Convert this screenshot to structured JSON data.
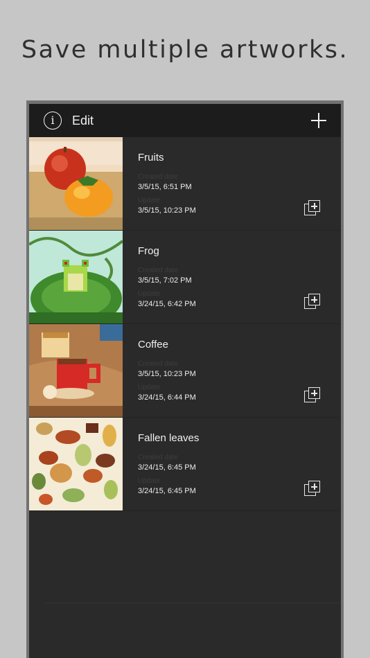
{
  "headline": "Save multiple artworks.",
  "navbar": {
    "info_glyph": "i",
    "edit_label": "Edit",
    "info_icon": "info-circle-icon",
    "add_icon": "plus-icon"
  },
  "labels": {
    "created": "Created date",
    "updated": "Update"
  },
  "artworks": [
    {
      "title": "Fruits",
      "created": "3/5/15, 6:51 PM",
      "updated": "3/5/15, 10:23 PM"
    },
    {
      "title": "Frog",
      "created": "3/5/15, 7:02 PM",
      "updated": "3/24/15, 6:42 PM"
    },
    {
      "title": "Coffee",
      "created": "3/5/15, 10:23 PM",
      "updated": "3/24/15, 6:44 PM"
    },
    {
      "title": "Fallen leaves",
      "created": "3/24/15, 6:45 PM",
      "updated": "3/24/15, 6:45 PM"
    }
  ],
  "colors": {
    "background": "#c6c6c6",
    "navbar": "#1c1c1c",
    "list": "#2a2a2a"
  }
}
